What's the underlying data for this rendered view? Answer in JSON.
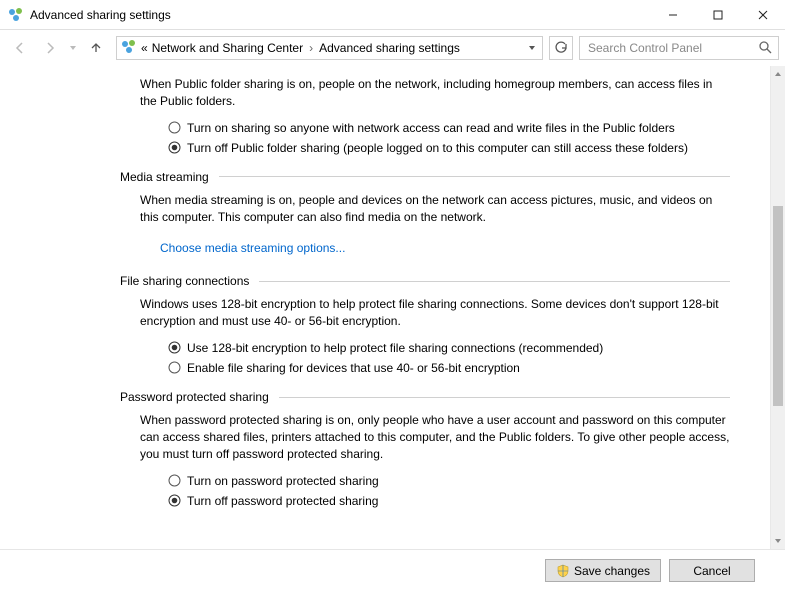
{
  "window": {
    "title": "Advanced sharing settings"
  },
  "breadcrumb": {
    "ellipsis": "«",
    "item1": "Network and Sharing Center",
    "item2": "Advanced sharing settings"
  },
  "search": {
    "placeholder": "Search Control Panel"
  },
  "sections": {
    "public_folder": {
      "desc": "When Public folder sharing is on, people on the network, including homegroup members, can access files in the Public folders.",
      "opt_on": "Turn on sharing so anyone with network access can read and write files in the Public folders",
      "opt_off": "Turn off Public folder sharing (people logged on to this computer can still access these folders)"
    },
    "media": {
      "header": "Media streaming",
      "desc": "When media streaming is on, people and devices on the network can access pictures, music, and videos on this computer. This computer can also find media on the network.",
      "link": "Choose media streaming options..."
    },
    "filesharing": {
      "header": "File sharing connections",
      "desc": "Windows uses 128-bit encryption to help protect file sharing connections. Some devices don't support 128-bit encryption and must use 40- or 56-bit encryption.",
      "opt_128": "Use 128-bit encryption to help protect file sharing connections (recommended)",
      "opt_low": "Enable file sharing for devices that use 40- or 56-bit encryption"
    },
    "password": {
      "header": "Password protected sharing",
      "desc": "When password protected sharing is on, only people who have a user account and password on this computer can access shared files, printers attached to this computer, and the Public folders. To give other people access, you must turn off password protected sharing.",
      "opt_on": "Turn on password protected sharing",
      "opt_off": "Turn off password protected sharing"
    }
  },
  "buttons": {
    "save": "Save changes",
    "cancel": "Cancel"
  }
}
